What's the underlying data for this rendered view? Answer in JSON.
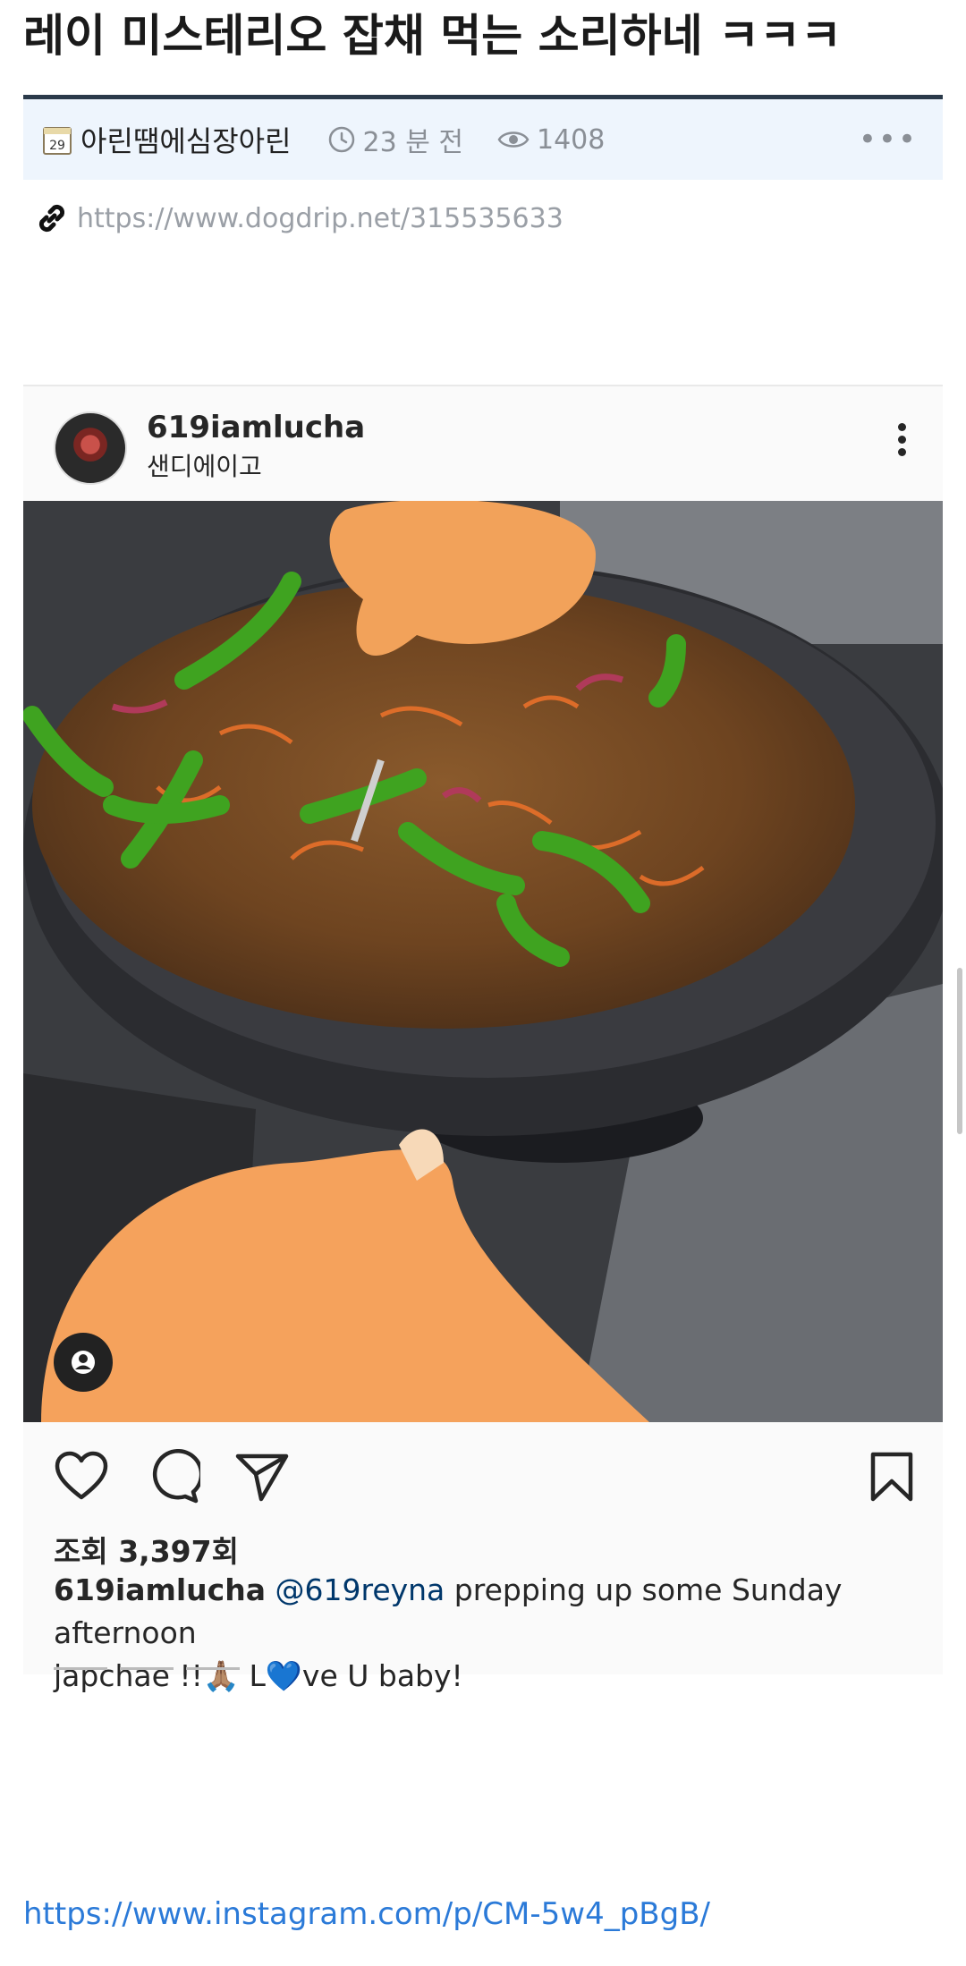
{
  "post": {
    "title": "레이 미스테리오 잡채 먹는 소리하네 ㅋㅋㅋ",
    "author": "아린땜에심장아린",
    "author_icon_day": "29",
    "time_ago": "23 분 전",
    "views": "1408",
    "source_url": "https://www.dogdrip.net/315535633"
  },
  "instagram": {
    "username": "619iamlucha",
    "location": "샌디에이고",
    "views_label": "조회 3,397회",
    "caption": {
      "username": "619iamlucha",
      "mention": "@619reyna",
      "text_line1": " prepping up some Sunday afternoon",
      "text_line2": "japchae !!🙏🏽 L💙ve U baby!"
    },
    "embed_link": "https://www.instagram.com/p/CM-5w4_pBgB/"
  },
  "colors": {
    "meta_bg": "#eef5fd",
    "title_rule": "#2b3a4a",
    "link_blue": "#2b7ad8",
    "mention_blue": "#00376b"
  }
}
